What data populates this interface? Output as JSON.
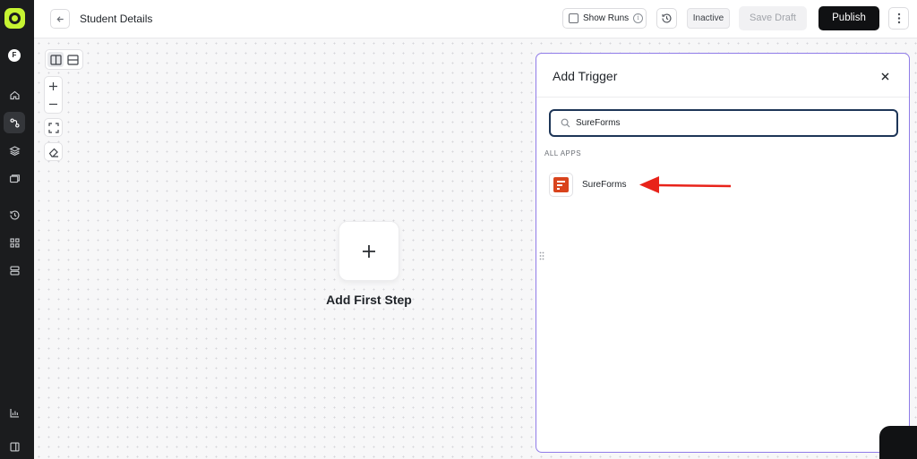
{
  "header": {
    "title": "Student Details",
    "show_runs_label": "Show Runs",
    "status": "Inactive",
    "save_draft_label": "Save Draft",
    "publish_label": "Publish"
  },
  "sidebar": {
    "avatar_initial": "F",
    "items": [
      {
        "icon": "home-icon"
      },
      {
        "icon": "workflow-icon",
        "active": true
      },
      {
        "icon": "layers-icon"
      },
      {
        "icon": "folders-icon"
      },
      {
        "icon": "history-icon"
      },
      {
        "icon": "apps-grid-icon"
      },
      {
        "icon": "server-icon"
      },
      {
        "icon": "analytics-icon"
      },
      {
        "icon": "collapse-sidebar-icon"
      }
    ]
  },
  "canvas": {
    "add_step_label": "Add First Step"
  },
  "trigger_panel": {
    "title": "Add Trigger",
    "search_value": "SureForms",
    "section_label": "ALL APPS",
    "apps": [
      {
        "name": "SureForms"
      }
    ]
  },
  "colors": {
    "accent_lime": "#c6f432",
    "sidebar_bg": "#1b1c1e",
    "panel_border": "#8f7be8",
    "search_border": "#1d3557",
    "sureforms_brand": "#d9441d",
    "annotation_arrow": "#e8231a"
  }
}
